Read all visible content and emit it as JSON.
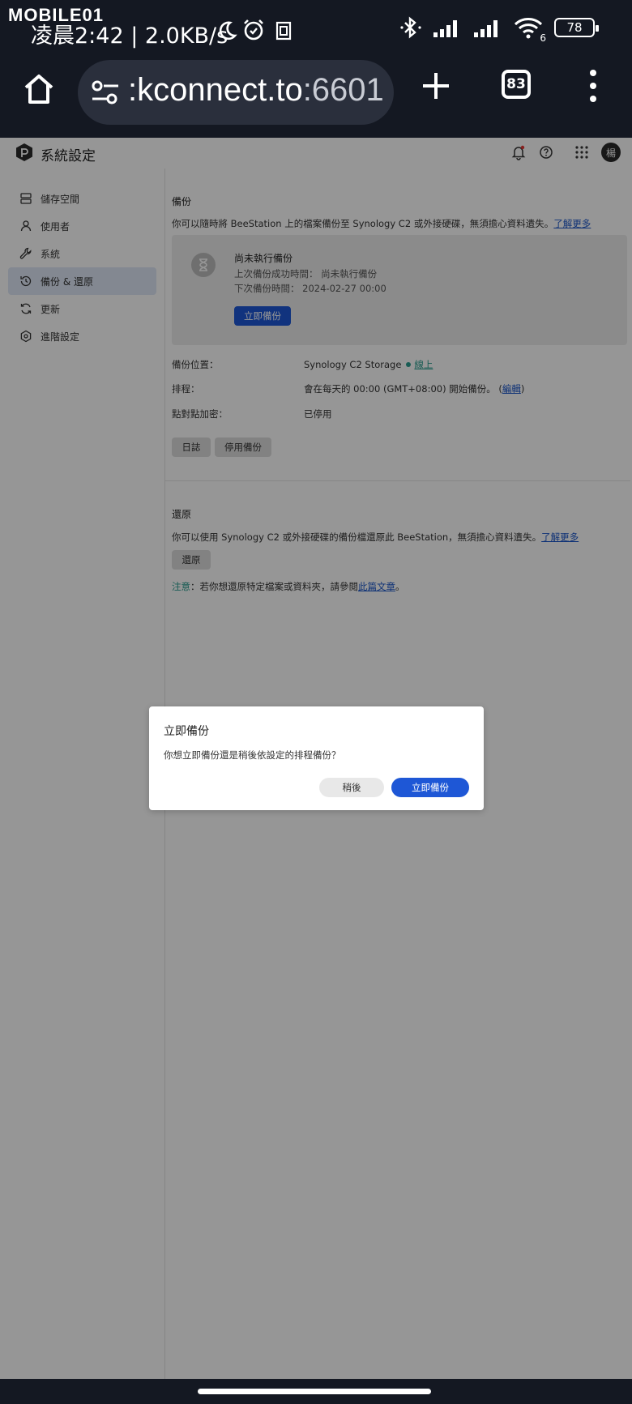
{
  "status_bar": {
    "watermark": "MOBILE01",
    "time_speed": "凌晨2:42 | 2.0KB/s",
    "battery": "78",
    "signal_badge": "6"
  },
  "browser": {
    "url_main": ":kconnect.to",
    "url_port": ":6601",
    "tab_count": "83"
  },
  "app": {
    "title": "系統設定",
    "avatar": "楊"
  },
  "sidebar": {
    "items": [
      {
        "label": "儲存空間",
        "icon": "storage-icon"
      },
      {
        "label": "使用者",
        "icon": "user-icon"
      },
      {
        "label": "系統",
        "icon": "wrench-icon"
      },
      {
        "label": "備份 & 還原",
        "icon": "backup-restore-icon",
        "active": true
      },
      {
        "label": "更新",
        "icon": "update-icon"
      },
      {
        "label": "進階設定",
        "icon": "advanced-settings-icon"
      }
    ]
  },
  "backup": {
    "title": "備份",
    "description": "你可以隨時將 BeeStation 上的檔案備份至 Synology C2 或外接硬碟，無須擔心資料遺失。",
    "learn_more": "了解更多",
    "status": {
      "title": "尚未執行備份",
      "last_backup": "上次備份成功時間： 尚未執行備份",
      "next_backup": "下次備份時間： 2024-02-27 00:00",
      "button": "立即備份"
    },
    "location_label": "備份位置：",
    "location_value": "Synology C2 Storage",
    "location_status": "線上",
    "schedule_label": "排程：",
    "schedule_value": "會在每天的 00:00 (GMT+08:00) 開始備份。",
    "schedule_edit": "編輯",
    "encryption_label": "點對點加密：",
    "encryption_value": "已停用",
    "log_button": "日誌",
    "disable_button": "停用備份"
  },
  "restore": {
    "title": "還原",
    "description": "你可以使用 Synology C2 或外接硬碟的備份檔還原此 BeeStation，無須擔心資料遺失。",
    "learn_more": "了解更多",
    "button": "還原",
    "note_prefix": "注意",
    "note_text": "：若你想還原特定檔案或資料夾，請參閱",
    "note_link": "此篇文章",
    "note_end": "。"
  },
  "dialog": {
    "title": "立即備份",
    "message": "你想立即備份還是稍後依設定的排程備份？",
    "later": "稍後",
    "now": "立即備份"
  },
  "colors": {
    "accent": "#1e57d6",
    "online": "#2a9d8f",
    "overlay": "rgba(0,0,0,0.41)"
  }
}
